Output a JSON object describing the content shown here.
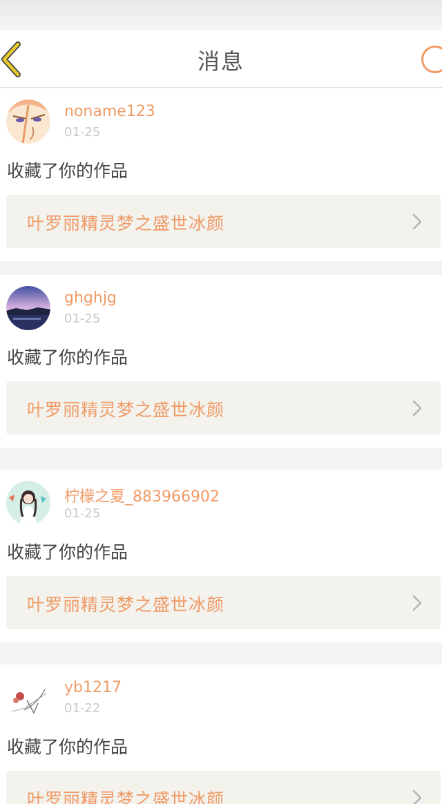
{
  "header": {
    "title": "消息"
  },
  "messages": [
    {
      "username": "noname123",
      "date": "01-25",
      "action": "收藏了你的作品",
      "work_title": "叶罗丽精灵梦之盛世冰颜"
    },
    {
      "username": "ghghjg",
      "date": "01-25",
      "action": "收藏了你的作品",
      "work_title": "叶罗丽精灵梦之盛世冰颜"
    },
    {
      "username": "柠檬之夏_883966902",
      "date": "01-25",
      "action": "收藏了你的作品",
      "work_title": "叶罗丽精灵梦之盛世冰颜"
    },
    {
      "username": "yb1217",
      "date": "01-22",
      "action": "收藏了你的作品",
      "work_title": "叶罗丽精灵梦之盛世冰颜"
    }
  ],
  "colors": {
    "accent": "#f09a66",
    "card_link_bg": "#f3f2ed",
    "back_icon": "#e9cc2a"
  }
}
